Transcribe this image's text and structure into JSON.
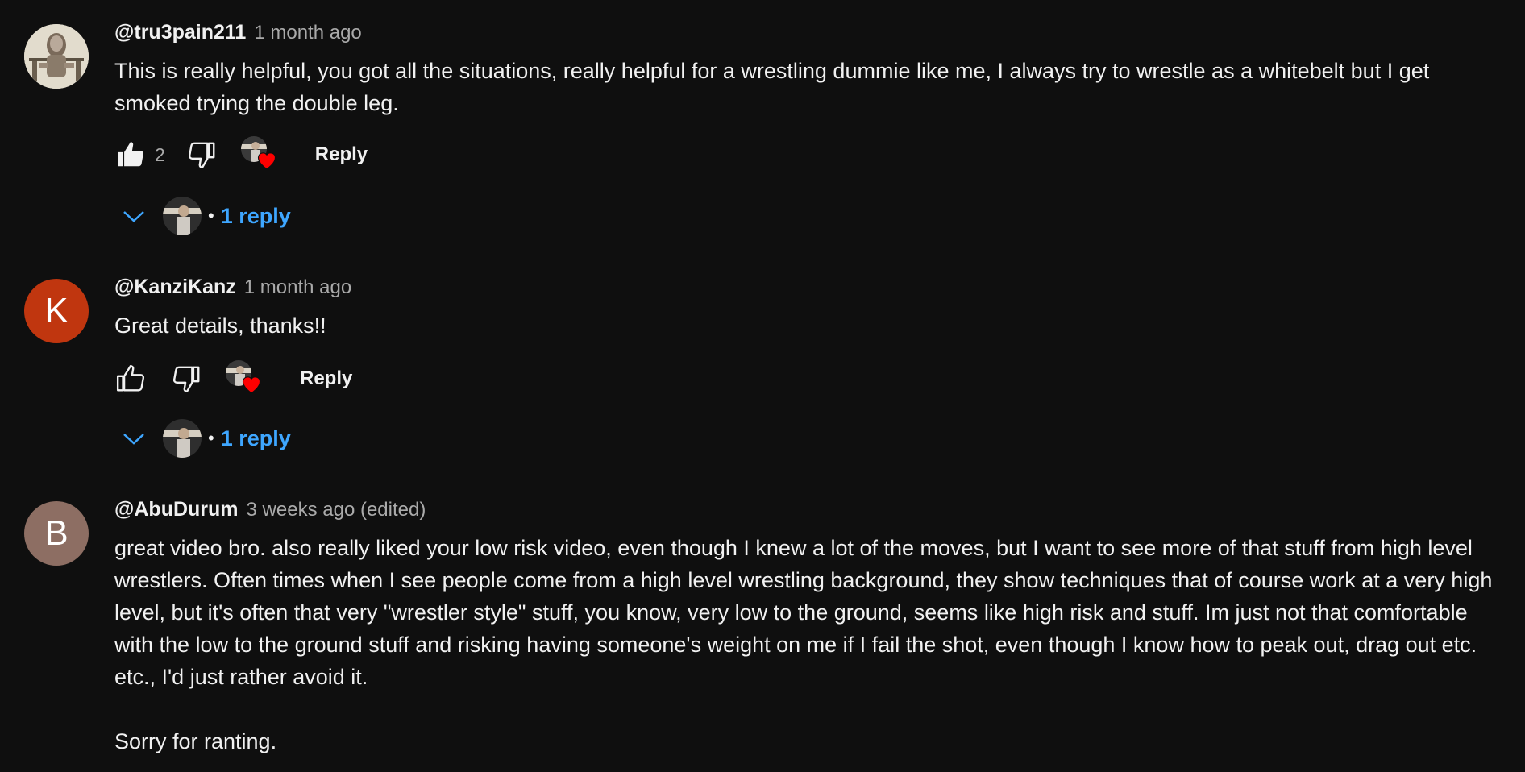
{
  "comments": [
    {
      "author": "@tru3pain211",
      "time": "1 month ago",
      "avatar_type": "image",
      "text": "This is really helpful, you got all the situations, really helpful for a wrestling dummie like me, I always try to wrestle as a whitebelt but I get smoked trying the double leg.",
      "likes": "2",
      "liked": true,
      "reply_label": "Reply",
      "replies_label": "1 reply"
    },
    {
      "author": "@KanziKanz",
      "time": "1 month ago",
      "avatar_type": "letter",
      "avatar_letter": "K",
      "avatar_color": "#c0360f",
      "text": "Great details, thanks!!",
      "likes": "",
      "liked": false,
      "reply_label": "Reply",
      "replies_label": "1 reply"
    },
    {
      "author": "@AbuDurum",
      "time": "3 weeks ago (edited)",
      "avatar_type": "letter",
      "avatar_letter": "B",
      "avatar_color": "#8d6e63",
      "text": "great video bro. also really liked your low risk video, even though I knew a lot of the moves, but I want to see more of that stuff from high level wrestlers. Often times when I see people come from a high level wrestling background, they show techniques that of course work at a very high level, but it's often that very \"wrestler style\" stuff, you know, very low to the ground, seems like high risk and stuff. Im just not that comfortable with the low to the ground stuff and risking having someone's weight on me if I fail the shot, even though I know how to peak out, drag out etc. etc., I'd just rather avoid it.\n\nSorry for ranting."
    }
  ],
  "colors": {
    "background": "#0f0f0f",
    "text": "#f1f1f1",
    "secondary_text": "#aaaaaa",
    "link_blue": "#3ea6ff",
    "heart_red": "#ff0000"
  },
  "icons": {
    "like": "thumbs-up-icon",
    "dislike": "thumbs-down-icon",
    "heart": "heart-icon",
    "expand": "chevron-down-icon"
  }
}
